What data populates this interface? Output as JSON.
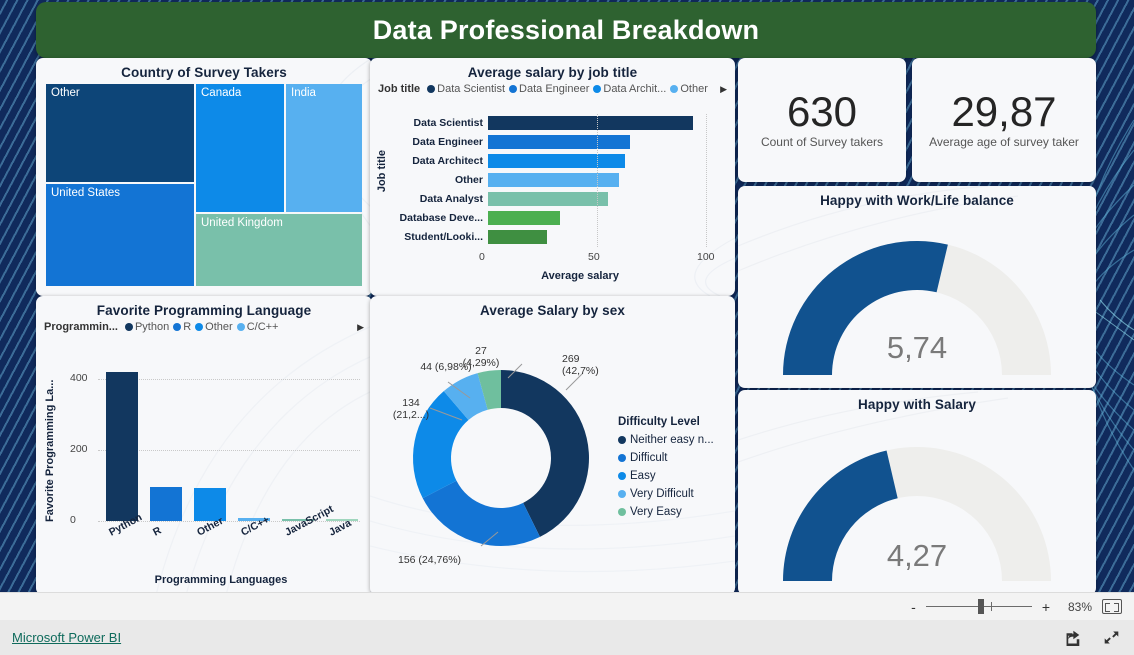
{
  "report": {
    "title": "Data Professional Breakdown",
    "title_bg": "#2e6230",
    "canvas_bg": "#102a5c"
  },
  "treemap": {
    "title": "Country of Survey Takers",
    "cells": [
      {
        "label": "Other",
        "color": "#0d4578"
      },
      {
        "label": "United States",
        "color": "#1374d4"
      },
      {
        "label": "Canada",
        "color": "#0d8ae8"
      },
      {
        "label": "India",
        "color": "#57b0f0"
      },
      {
        "label": "United Kingdom",
        "color": "#79c0aa"
      }
    ]
  },
  "salary_chart": {
    "title": "Average salary by job title",
    "legend_title": "Job title",
    "legend": [
      {
        "label": "Data Scientist",
        "color": "#12375f"
      },
      {
        "label": "Data Engineer",
        "color": "#1374d4"
      },
      {
        "label": "Data Archit...",
        "color": "#0d8ae8"
      },
      {
        "label": "Other",
        "color": "#57b0f0"
      }
    ],
    "more_arrow": "▶"
  },
  "kpi_cards": [
    {
      "value": "630",
      "label": "Count of Survey takers"
    },
    {
      "value": "29,87",
      "label": "Average age of survey taker"
    }
  ],
  "gauges": [
    {
      "title": "Happy with Work/Life balance",
      "value": "5,74",
      "min": "0",
      "max": "10",
      "fraction": 0.574,
      "color": "#11528f"
    },
    {
      "title": "Happy with Salary",
      "value": "4,27",
      "min": "0",
      "max": "10",
      "fraction": 0.427,
      "color": "#11528f"
    }
  ],
  "lang_chart": {
    "title": "Favorite Programming Language",
    "legend_title": "Programmin...",
    "legend": [
      {
        "label": "Python",
        "color": "#12375f"
      },
      {
        "label": "R",
        "color": "#1374d4"
      },
      {
        "label": "Other",
        "color": "#0d8ae8"
      },
      {
        "label": "C/C++",
        "color": "#57b0f0"
      }
    ],
    "more_arrow": "▶"
  },
  "donut": {
    "title": "Average Salary by sex",
    "legend_title": "Difficulty Level",
    "legend": [
      {
        "label": "Neither easy n...",
        "color": "#12375f"
      },
      {
        "label": "Difficult",
        "color": "#1374d4"
      },
      {
        "label": "Easy",
        "color": "#0d8ae8"
      },
      {
        "label": "Very Difficult",
        "color": "#57b0f0"
      },
      {
        "label": "Very Easy",
        "color": "#6fbf9e"
      }
    ],
    "labels": [
      {
        "line1": "269",
        "line2": "(42,7%)"
      },
      {
        "line1": "156 (24,76%)",
        "line2": ""
      },
      {
        "line1": "134",
        "line2": "(21,2...)"
      },
      {
        "line1": "44 (6,98%)",
        "line2": ""
      },
      {
        "line1": "27",
        "line2": "(4,29%)"
      }
    ]
  },
  "status_bar": {
    "minus": "-",
    "plus": "+",
    "zoom_percent": "83%",
    "fit_icon": "fit-to-page-icon"
  },
  "footer": {
    "brand": "Microsoft Power BI",
    "share_icon": "share-icon",
    "fullscreen_icon": "fullscreen-icon"
  },
  "chart_data": [
    {
      "type": "treemap",
      "title": "Country of Survey Takers",
      "categories": [
        "Other",
        "United States",
        "Canada",
        "India",
        "United Kingdom"
      ],
      "values": [
        28,
        24,
        19,
        16,
        13
      ],
      "colors": [
        "#0d4578",
        "#1374d4",
        "#0d8ae8",
        "#57b0f0",
        "#79c0aa"
      ]
    },
    {
      "type": "bar",
      "orientation": "horizontal",
      "title": "Average salary by job title",
      "categories": [
        "Data Scientist",
        "Data Engineer",
        "Data Architect",
        "Other",
        "Data Analyst",
        "Database Deve...",
        "Student/Looki..."
      ],
      "values": [
        94,
        65,
        63,
        60,
        55,
        33,
        27
      ],
      "colors": [
        "#12375f",
        "#1374d4",
        "#0d8ae8",
        "#57b0f0",
        "#79c0aa",
        "#4caf50",
        "#3f8f41"
      ],
      "xlabel": "Average salary",
      "ylabel": "Job title",
      "xlim": [
        0,
        100
      ],
      "xticks": [
        0,
        50,
        100
      ],
      "grid": true,
      "legend_position": "top"
    },
    {
      "type": "bar",
      "orientation": "vertical",
      "title": "Favorite Programming Language",
      "categories": [
        "Python",
        "R",
        "Other",
        "C/C++",
        "JavaScript",
        "Java"
      ],
      "values": [
        420,
        95,
        92,
        8,
        5,
        2
      ],
      "colors": [
        "#12375f",
        "#1374d4",
        "#0d8ae8",
        "#57b0f0",
        "#79c0aa",
        "#9fd6bd"
      ],
      "xlabel": "Programming Languages",
      "ylabel": "Favorite Programming La...",
      "ylim": [
        0,
        450
      ],
      "yticks": [
        0,
        200,
        400
      ],
      "grid": true,
      "legend_position": "top"
    },
    {
      "type": "pie",
      "variant": "donut",
      "title": "Average Salary by sex",
      "legend_title": "Difficulty Level",
      "categories": [
        "Neither easy n...",
        "Difficult",
        "Easy",
        "Very Difficult",
        "Very Easy"
      ],
      "values": [
        269,
        156,
        134,
        44,
        27
      ],
      "percents": [
        42.7,
        24.76,
        21.2,
        6.98,
        4.29
      ],
      "colors": [
        "#12375f",
        "#1374d4",
        "#0d8ae8",
        "#57b0f0",
        "#6fbf9e"
      ],
      "legend_position": "right"
    },
    {
      "type": "gauge",
      "title": "Happy with Work/Life balance",
      "value": 5.74,
      "min": 0,
      "max": 10,
      "color": "#11528f"
    },
    {
      "type": "gauge",
      "title": "Happy with Salary",
      "value": 4.27,
      "min": 0,
      "max": 10,
      "color": "#11528f"
    }
  ]
}
